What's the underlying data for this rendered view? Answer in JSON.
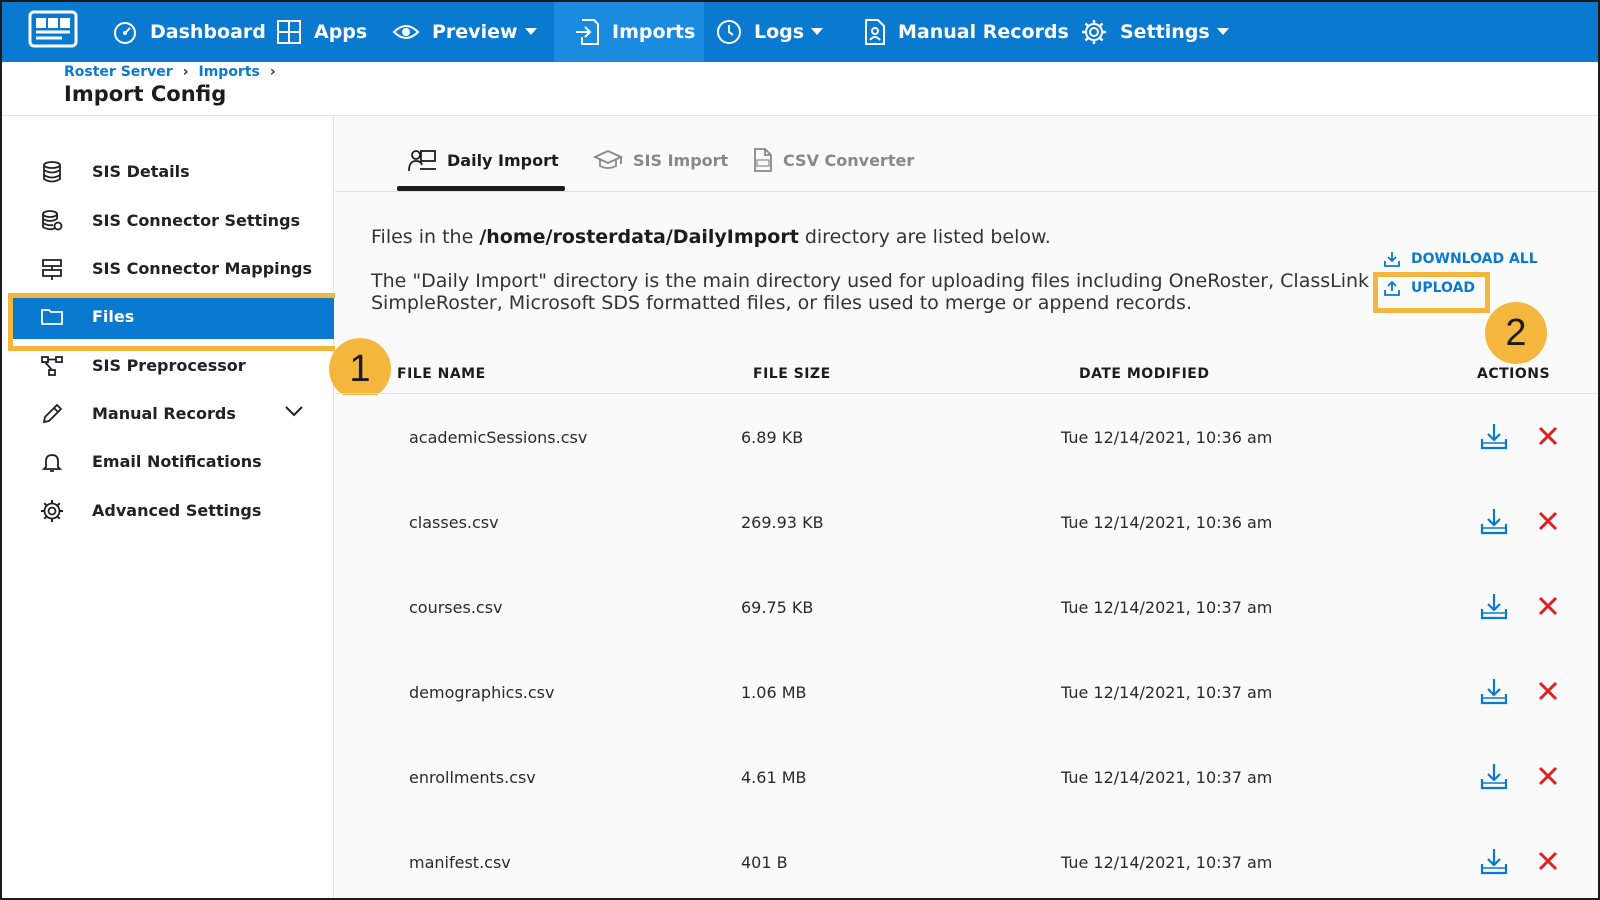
{
  "nav": {
    "items": [
      {
        "label": "Dashboard"
      },
      {
        "label": "Apps"
      },
      {
        "label": "Preview"
      },
      {
        "label": "Imports"
      },
      {
        "label": "Logs"
      },
      {
        "label": "Manual Records"
      },
      {
        "label": "Settings"
      }
    ],
    "active": "Imports"
  },
  "breadcrumb": [
    "Roster Server",
    "Imports"
  ],
  "page_title": "Import Config",
  "sidebar": {
    "items": [
      {
        "label": "SIS Details",
        "icon": "database-icon"
      },
      {
        "label": "SIS Connector Settings",
        "icon": "database-gear-icon"
      },
      {
        "label": "SIS Connector Mappings",
        "icon": "mapping-icon"
      },
      {
        "label": "Files",
        "icon": "folder-icon"
      },
      {
        "label": "SIS Preprocessor",
        "icon": "flow-icon"
      },
      {
        "label": "Manual Records",
        "icon": "pencil-icon"
      },
      {
        "label": "Email Notifications",
        "icon": "bell-icon"
      },
      {
        "label": "Advanced Settings",
        "icon": "gear-icon"
      }
    ],
    "active": "Files"
  },
  "tabs": [
    {
      "label": "Daily Import"
    },
    {
      "label": "SIS Import"
    },
    {
      "label": "CSV Converter"
    }
  ],
  "intro": {
    "prefix": "Files in the ",
    "path": "/home/rosterdata/DailyImport",
    "suffix": " directory are listed below.",
    "description": "The \"Daily Import\" directory is the main directory used for uploading files including OneRoster, ClassLink SimpleRoster, Microsoft SDS formatted files, or files used to merge or append records."
  },
  "actions": {
    "download_all": "DOWNLOAD ALL",
    "upload": "UPLOAD"
  },
  "callouts": [
    "1",
    "2"
  ],
  "table": {
    "columns": [
      "FILE NAME",
      "FILE SIZE",
      "DATE MODIFIED",
      "ACTIONS"
    ],
    "rows": [
      {
        "name": "academicSessions.csv",
        "size": "6.89 KB",
        "modified": "Tue 12/14/2021, 10:36 am"
      },
      {
        "name": "classes.csv",
        "size": "269.93 KB",
        "modified": "Tue 12/14/2021, 10:36 am"
      },
      {
        "name": "courses.csv",
        "size": "69.75 KB",
        "modified": "Tue 12/14/2021, 10:37 am"
      },
      {
        "name": "demographics.csv",
        "size": "1.06 MB",
        "modified": "Tue 12/14/2021, 10:37 am"
      },
      {
        "name": "enrollments.csv",
        "size": "4.61 MB",
        "modified": "Tue 12/14/2021, 10:37 am"
      },
      {
        "name": "manifest.csv",
        "size": "401 B",
        "modified": "Tue 12/14/2021, 10:37 am"
      }
    ]
  },
  "colors": {
    "brand_blue": "#0a7ad0",
    "highlight": "#f4b63d",
    "delete_red": "#e02020"
  }
}
